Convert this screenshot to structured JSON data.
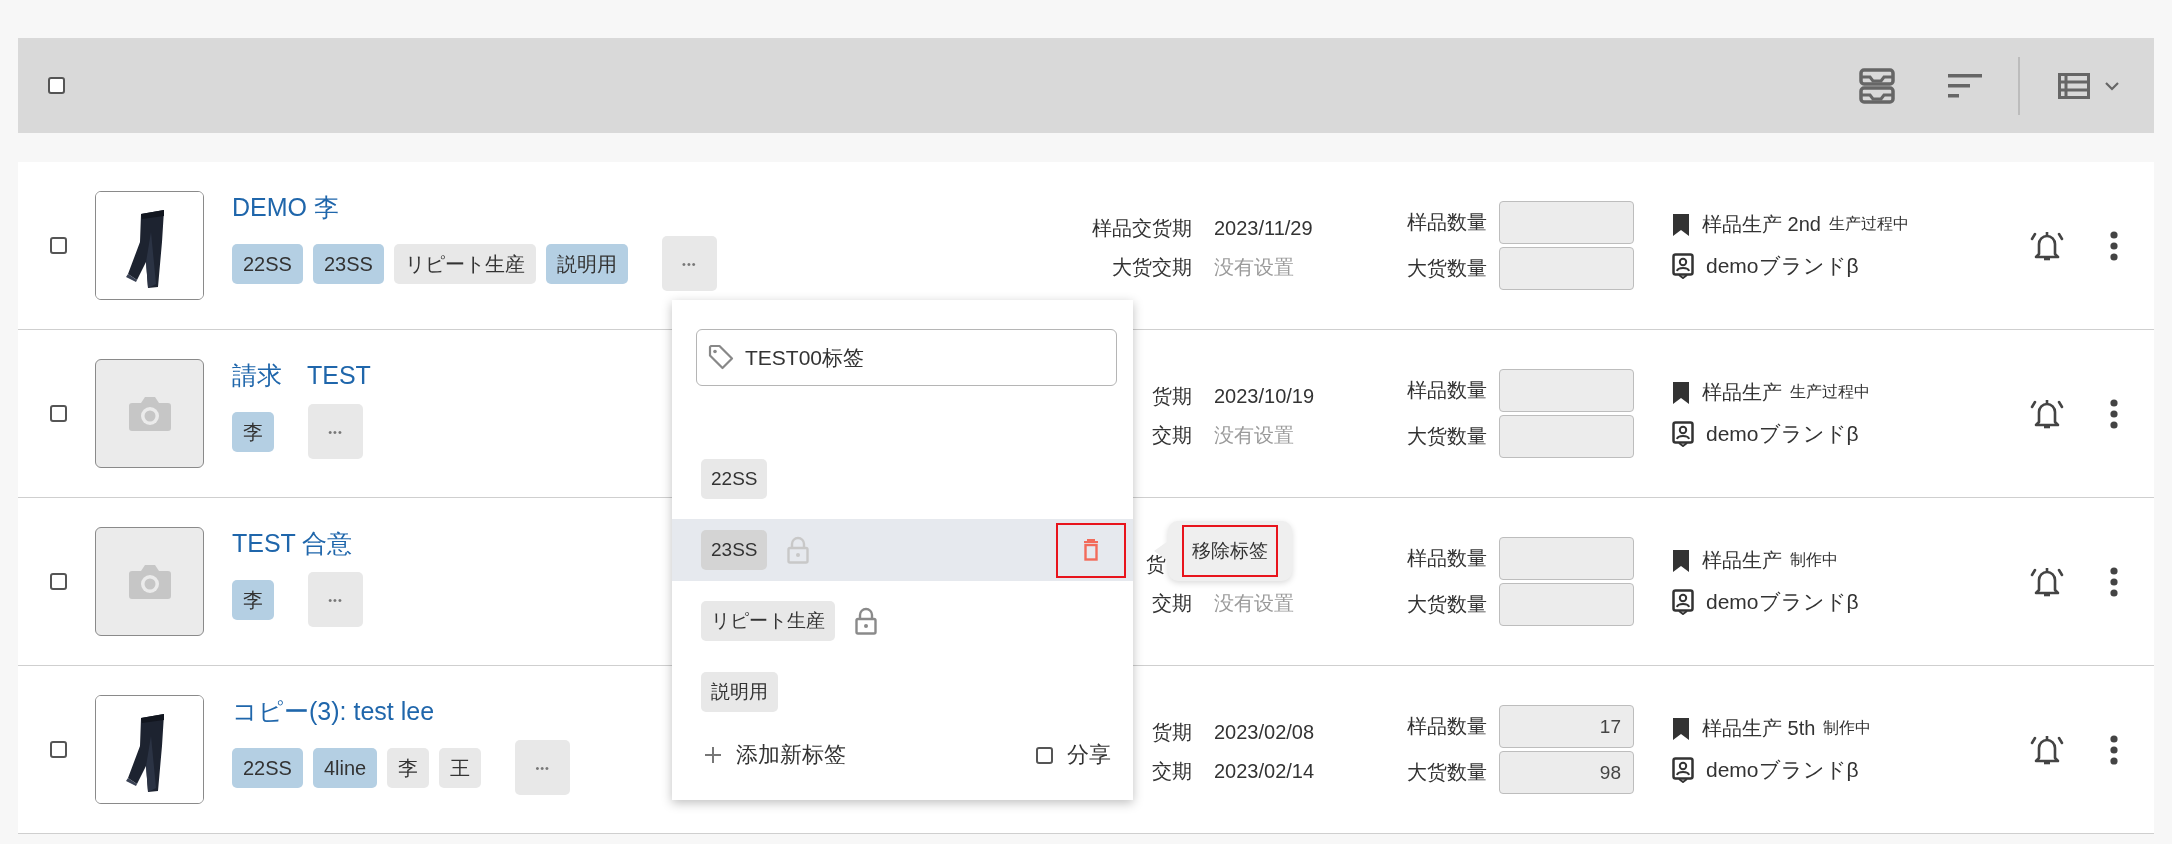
{
  "toolbar": {
    "select_all": {
      "checked": false
    }
  },
  "rows": [
    {
      "checked": false,
      "title": "DEMO 李",
      "tags": [
        {
          "label": "22SS",
          "color": "#b4cfe3"
        },
        {
          "label": "23SS",
          "color": "#b4cfe3"
        },
        {
          "label": "リピート生産",
          "color": "#e8e8e8"
        },
        {
          "label": "説明用",
          "color": "#b4cfe3"
        }
      ],
      "more": "•••",
      "dates": [
        {
          "label": "样品交货期",
          "value": "2023/11/29",
          "empty": false
        },
        {
          "label": "大货交期",
          "value": "没有设置",
          "empty": true
        }
      ],
      "quantities": [
        {
          "label": "样品数量"
        },
        {
          "label": "大货数量"
        }
      ],
      "status": {
        "stage": "样品生产 2nd",
        "note": "生产过程中"
      },
      "brand": "demoブランドβ"
    },
    {
      "checked": false,
      "thumb": {
        "kind": "placeholder"
      },
      "title": "請求　TEST",
      "tags": [
        {
          "label": "李",
          "color": "#b4cfe3"
        }
      ],
      "more": "•••",
      "dates": [
        {
          "label": "货期",
          "value": "2023/10/19",
          "empty": false
        },
        {
          "label": "交期",
          "value": "没有设置",
          "empty": true
        }
      ],
      "quantities": [
        {
          "label": "样品数量"
        },
        {
          "label": "大货数量"
        }
      ],
      "status": {
        "stage": "样品生产",
        "note": "生产过程中"
      },
      "brand": "demoブランドβ"
    },
    {
      "checked": false,
      "thumb": {
        "kind": "placeholder"
      },
      "title": "TEST 合意",
      "tags": [
        {
          "label": "李",
          "color": "#b4cfe3"
        }
      ],
      "more": "•••",
      "dates": [
        {
          "label": "货",
          "label_cut": true
        },
        {
          "label": "交期",
          "value": "没有设置",
          "empty": true
        }
      ],
      "quantities": [
        {
          "label": "样品数量"
        },
        {
          "label": "大货数量"
        }
      ],
      "status": {
        "stage": "样品生产",
        "note": "制作中"
      },
      "brand": "demoブランドβ"
    },
    {
      "checked": false,
      "title": "コピー(3): test lee",
      "tags": [
        {
          "label": "22SS",
          "color": "#b4cfe3"
        },
        {
          "label": "4line",
          "color": "#b4cfe3"
        },
        {
          "label": "李",
          "color": "#e8e8e8"
        },
        {
          "label": "王",
          "color": "#e8e8e8"
        }
      ],
      "more": "•••",
      "dates": [
        {
          "label": "货期",
          "value": "2023/02/08",
          "empty": false
        },
        {
          "label": "交期",
          "value": "2023/02/14",
          "empty": false
        }
      ],
      "quantities": [
        {
          "label": "样品数量",
          "value": "17"
        },
        {
          "label": "大货数量",
          "value": "98"
        }
      ],
      "status": {
        "stage": "样品生产 5th",
        "note": "制作中"
      },
      "brand": "demoブランドβ"
    }
  ],
  "tag_popup": {
    "search": {
      "value": "TEST00标签"
    },
    "items": [
      {
        "label": "22SS",
        "selected": false,
        "locked": false
      },
      {
        "label": "23SS",
        "selected": true,
        "locked": true,
        "lock_dimmed": true
      },
      {
        "label": "リピート生産",
        "selected": false,
        "locked": true,
        "lock_dimmed": false
      },
      {
        "label": "説明用",
        "selected": false,
        "locked": false
      }
    ],
    "add_label": "添加新标签",
    "share": {
      "label": "分享",
      "checked": false
    }
  },
  "tooltip": {
    "text": "移除标签"
  }
}
